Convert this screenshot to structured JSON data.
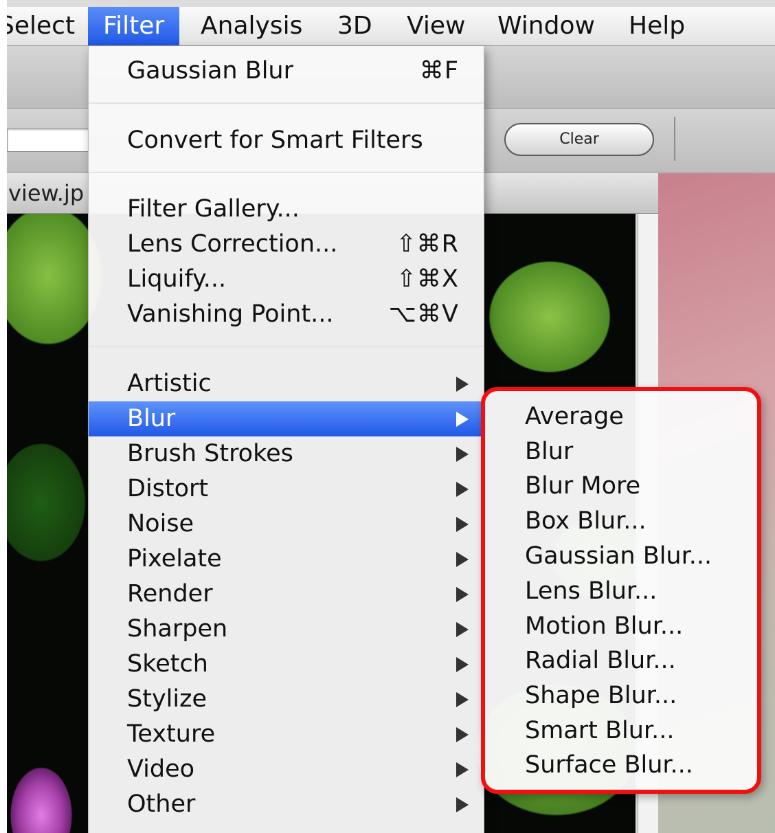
{
  "menubar": {
    "items": [
      {
        "label": "Select"
      },
      {
        "label": "Filter"
      },
      {
        "label": "Analysis"
      },
      {
        "label": "3D"
      },
      {
        "label": "View"
      },
      {
        "label": "Window"
      },
      {
        "label": "Help"
      }
    ],
    "active": "Filter"
  },
  "toolbar": {
    "clear_label": "Clear"
  },
  "document": {
    "title": "view.jp"
  },
  "filter_menu": {
    "last_filter": {
      "label": "Gaussian Blur",
      "shortcut": "⌘F"
    },
    "smart_filters": {
      "label": "Convert for Smart Filters"
    },
    "tools": [
      {
        "label": "Filter Gallery...",
        "shortcut": ""
      },
      {
        "label": "Lens Correction...",
        "shortcut": "⇧⌘R"
      },
      {
        "label": "Liquify...",
        "shortcut": "⇧⌘X"
      },
      {
        "label": "Vanishing Point...",
        "shortcut": "⌥⌘V"
      }
    ],
    "categories": [
      {
        "label": "Artistic"
      },
      {
        "label": "Blur"
      },
      {
        "label": "Brush Strokes"
      },
      {
        "label": "Distort"
      },
      {
        "label": "Noise"
      },
      {
        "label": "Pixelate"
      },
      {
        "label": "Render"
      },
      {
        "label": "Sharpen"
      },
      {
        "label": "Sketch"
      },
      {
        "label": "Stylize"
      },
      {
        "label": "Texture"
      },
      {
        "label": "Video"
      },
      {
        "label": "Other"
      }
    ],
    "highlighted": "Blur"
  },
  "blur_submenu": {
    "items": [
      {
        "label": "Average"
      },
      {
        "label": "Blur"
      },
      {
        "label": "Blur More"
      },
      {
        "label": "Box Blur..."
      },
      {
        "label": "Gaussian Blur..."
      },
      {
        "label": "Lens Blur..."
      },
      {
        "label": "Motion Blur..."
      },
      {
        "label": "Radial Blur..."
      },
      {
        "label": "Shape Blur..."
      },
      {
        "label": "Smart Blur..."
      },
      {
        "label": "Surface Blur..."
      }
    ]
  },
  "colors": {
    "highlight": "#2a63ec",
    "annotation_border": "#f10f0f"
  }
}
